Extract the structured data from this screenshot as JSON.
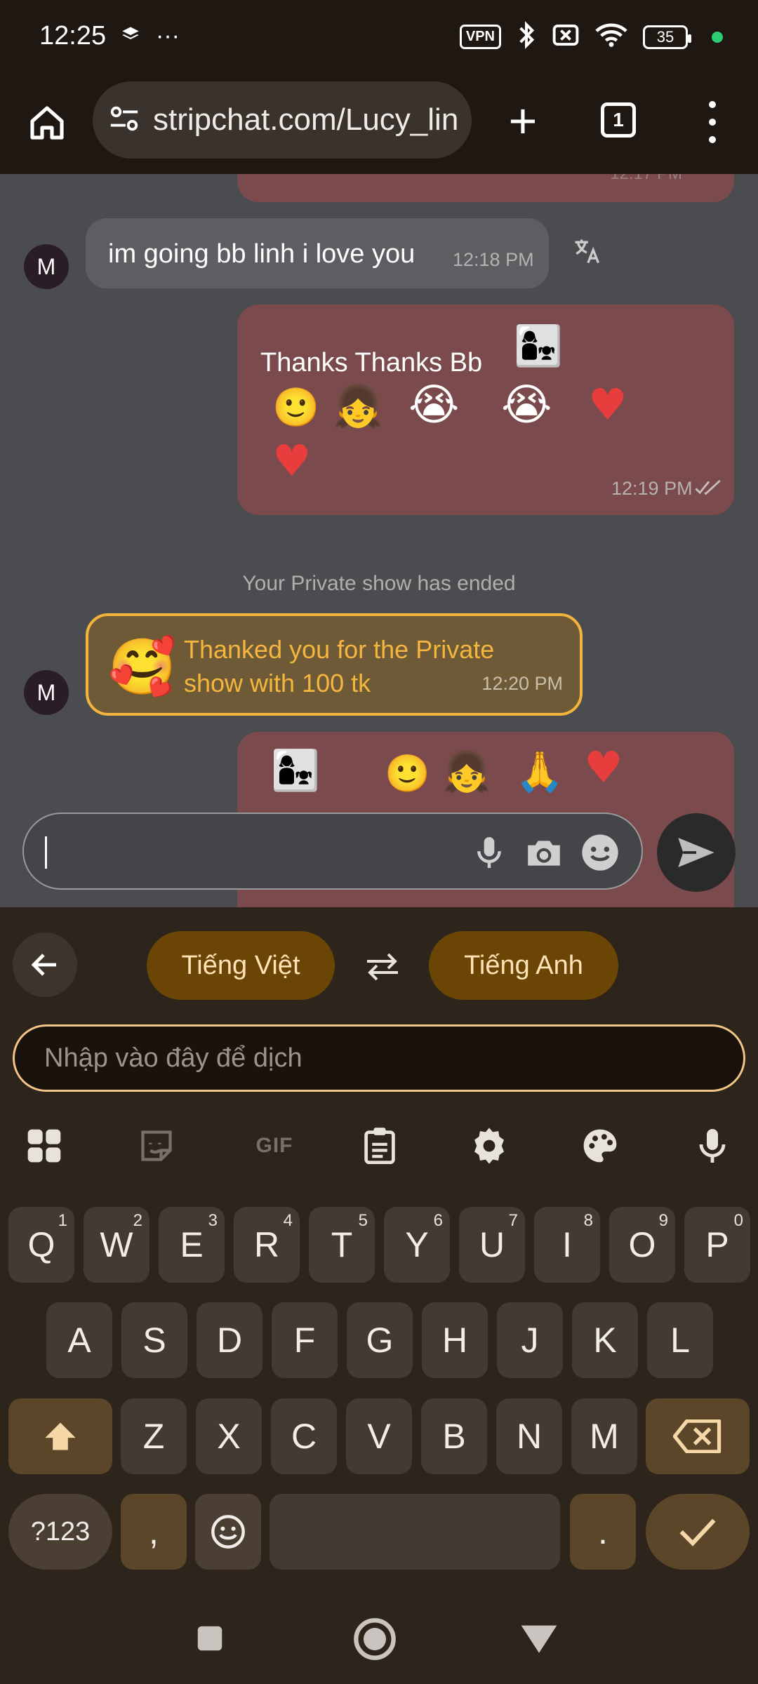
{
  "status_bar": {
    "time": "12:25",
    "more_indicator": "···",
    "vpn_label": "VPN",
    "battery": "35"
  },
  "browser": {
    "url": "stripchat.com/Lucy_lin",
    "tab_count": "1"
  },
  "chat": {
    "partial_top_time": "12:17 PM",
    "messages": [
      {
        "avatar": "M",
        "text": "im going bb linh i love you",
        "time": "12:18 PM"
      },
      {
        "text": "Thanks Thanks Bb",
        "time": "12:19 PM"
      }
    ],
    "system_message": "Your Private show has ended",
    "tip": {
      "avatar": "M",
      "text": "Thanked you for the Private show with 100 tk",
      "time": "12:20 PM"
    }
  },
  "translator": {
    "source_language": "Tiếng Việt",
    "target_language": "Tiếng Anh",
    "input_placeholder": "Nhập vào đây để dịch"
  },
  "keyboard": {
    "gif_label": "GIF",
    "row1": [
      {
        "k": "Q",
        "h": "1"
      },
      {
        "k": "W",
        "h": "2"
      },
      {
        "k": "E",
        "h": "3"
      },
      {
        "k": "R",
        "h": "4"
      },
      {
        "k": "T",
        "h": "5"
      },
      {
        "k": "Y",
        "h": "6"
      },
      {
        "k": "U",
        "h": "7"
      },
      {
        "k": "I",
        "h": "8"
      },
      {
        "k": "O",
        "h": "9"
      },
      {
        "k": "P",
        "h": "0"
      }
    ],
    "row2": [
      "A",
      "S",
      "D",
      "F",
      "G",
      "H",
      "J",
      "K",
      "L"
    ],
    "row3": [
      "Z",
      "X",
      "C",
      "V",
      "B",
      "N",
      "M"
    ],
    "symbols_label": "?123",
    "comma_label": ",",
    "period_label": "."
  }
}
